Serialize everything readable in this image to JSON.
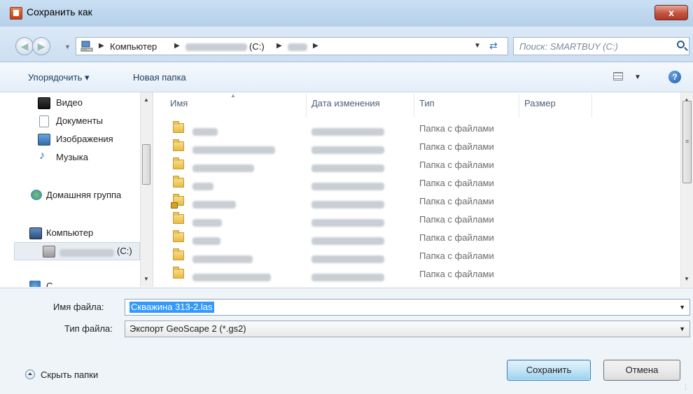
{
  "window": {
    "title": "Сохранить как",
    "close_glyph": "x"
  },
  "address": {
    "crumbs": [
      "Компьютер",
      "(C:)"
    ],
    "search_placeholder": "Поиск: SMARTBUY (C:)"
  },
  "toolbar": {
    "organize_label": "Упорядочить ▾",
    "new_folder_label": "Новая папка"
  },
  "nav": {
    "items": [
      {
        "label": "Видео",
        "icon": "video-icon"
      },
      {
        "label": "Документы",
        "icon": "documents-icon"
      },
      {
        "label": "Изображения",
        "icon": "pictures-icon"
      },
      {
        "label": "Музыка",
        "icon": "music-icon"
      },
      {
        "label": "Домашняя группа",
        "icon": "homegroup-icon"
      },
      {
        "label": "Компьютер",
        "icon": "computer-icon"
      },
      {
        "label": "(C:)",
        "icon": "drive-icon"
      }
    ],
    "partial_label": "С"
  },
  "columns": {
    "name": "Имя",
    "date": "Дата изменения",
    "type": "Тип",
    "size": "Размер"
  },
  "rows": [
    {
      "type": "Папка с файлами"
    },
    {
      "type": "Папка с файлами"
    },
    {
      "type": "Папка с файлами"
    },
    {
      "type": "Папка с файлами"
    },
    {
      "type": "Папка с файлами"
    },
    {
      "type": "Папка с файлами"
    },
    {
      "type": "Папка с файлами"
    },
    {
      "type": "Папка с файлами"
    },
    {
      "type": "Папка с файлами"
    }
  ],
  "form": {
    "filename_label": "Имя файла:",
    "filename_value": "Скважина 313-2.las",
    "filetype_label": "Тип файла:",
    "filetype_value": "Экспорт GeoScape 2 (*.gs2)"
  },
  "footer": {
    "hide_folders_label": "Скрыть папки",
    "save_label": "Сохранить",
    "cancel_label": "Отмена"
  }
}
